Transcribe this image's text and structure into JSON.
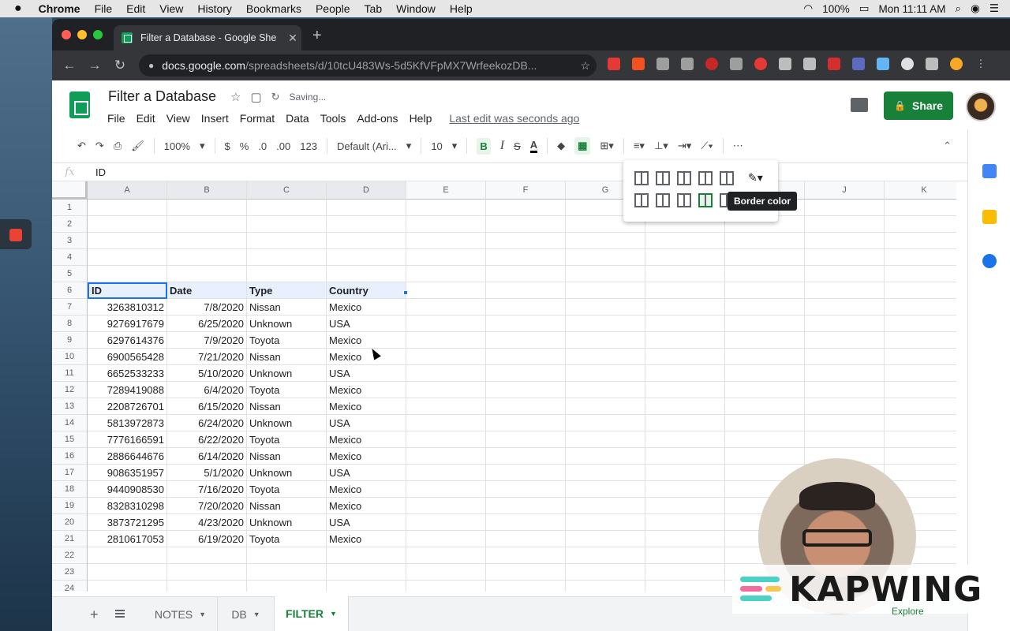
{
  "menubar": {
    "apple": "",
    "app": "Chrome",
    "items": [
      "File",
      "Edit",
      "View",
      "History",
      "Bookmarks",
      "People",
      "Tab",
      "Window",
      "Help"
    ],
    "battery": "100%",
    "clock": "Mon 11:11 AM"
  },
  "browser": {
    "tab_title": "Filter a Database - Google She",
    "tab_close": "✕",
    "new_tab": "+",
    "url_domain": "docs.google.com",
    "url_path": "/spreadsheets/d/10tcU483Ws-5d5KfVFpMX7WrfeekozDB...",
    "back": "←",
    "forward": "→",
    "reload": "↻",
    "bookmark_star": "☆"
  },
  "sheet": {
    "title": "Filter a Database",
    "saving": "Saving...",
    "menus": [
      "File",
      "Edit",
      "View",
      "Insert",
      "Format",
      "Data",
      "Tools",
      "Add-ons",
      "Help"
    ],
    "last_edit": "Last edit was seconds ago",
    "share": "Share",
    "share_icon": "🔒"
  },
  "toolbar": {
    "undo": "↶",
    "redo": "↷",
    "print": "⎙",
    "paint": "🖌",
    "zoom": "100%",
    "currency": "$",
    "percent": "%",
    "dec_less": ".0",
    "dec_more": ".00",
    "more_formats": "123",
    "font": "Default (Ari...",
    "font_size": "10",
    "bold": "B",
    "italic": "I",
    "strike": "S",
    "text_color": "A",
    "more": "⋯",
    "collapse": "⌃"
  },
  "formula": {
    "fx": "fx",
    "value": "ID"
  },
  "columns": [
    "A",
    "B",
    "C",
    "D",
    "E",
    "F",
    "G",
    "H",
    "I",
    "J",
    "K"
  ],
  "rows": [
    "1",
    "2",
    "3",
    "4",
    "5",
    "6",
    "7",
    "8",
    "9",
    "10",
    "11",
    "12",
    "13",
    "14",
    "15",
    "16",
    "17",
    "18",
    "19",
    "20",
    "21",
    "22",
    "23",
    "24"
  ],
  "header_row": [
    "ID",
    "Date",
    "Type",
    "Country"
  ],
  "data": [
    [
      "3263810312",
      "7/8/2020",
      "Nissan",
      "Mexico"
    ],
    [
      "9276917679",
      "6/25/2020",
      "Unknown",
      "USA"
    ],
    [
      "6297614376",
      "7/9/2020",
      "Toyota",
      "Mexico"
    ],
    [
      "6900565428",
      "7/21/2020",
      "Nissan",
      "Mexico"
    ],
    [
      "6652533233",
      "5/10/2020",
      "Unknown",
      "USA"
    ],
    [
      "7289419088",
      "6/4/2020",
      "Toyota",
      "Mexico"
    ],
    [
      "2208726701",
      "6/15/2020",
      "Nissan",
      "Mexico"
    ],
    [
      "5813972873",
      "6/24/2020",
      "Unknown",
      "USA"
    ],
    [
      "7776166591",
      "6/22/2020",
      "Toyota",
      "Mexico"
    ],
    [
      "2886644676",
      "6/14/2020",
      "Nissan",
      "Mexico"
    ],
    [
      "9086351957",
      "5/1/2020",
      "Unknown",
      "USA"
    ],
    [
      "9440908530",
      "7/16/2020",
      "Toyota",
      "Mexico"
    ],
    [
      "8328310298",
      "7/20/2020",
      "Nissan",
      "Mexico"
    ],
    [
      "3873721295",
      "4/23/2020",
      "Unknown",
      "USA"
    ],
    [
      "2810617053",
      "6/19/2020",
      "Toyota",
      "Mexico"
    ]
  ],
  "sheets": [
    {
      "name": "NOTES",
      "active": false
    },
    {
      "name": "DB",
      "active": false
    },
    {
      "name": "FILTER",
      "active": true
    }
  ],
  "add_sheet": "+",
  "tooltip": "Border color",
  "explore": "Explore",
  "watermark": "KAPWING",
  "colors": {
    "accent": "#188038",
    "selection": "#1a73e8"
  }
}
